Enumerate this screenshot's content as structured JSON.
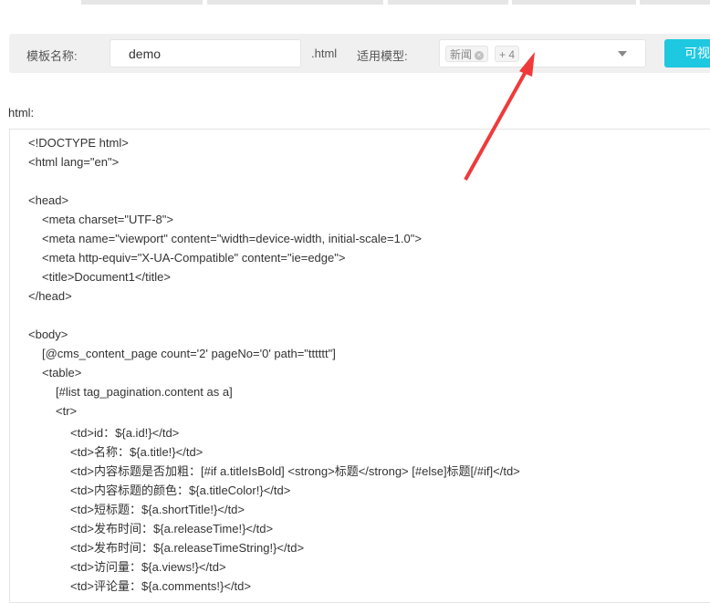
{
  "form": {
    "template_name_label": "模板名称:",
    "template_name_value": "demo",
    "suffix": ".html",
    "model_label": "适用模型:",
    "model_tags": [
      "新闻",
      "+ 4"
    ],
    "visual_button": "可视"
  },
  "html_label": "html:",
  "code_lines": [
    {
      "i": 0,
      "t": "<!DOCTYPE html>"
    },
    {
      "i": 0,
      "t": "<html lang=\"en\">"
    },
    {
      "i": 0,
      "t": ""
    },
    {
      "i": 0,
      "t": "<head>"
    },
    {
      "i": 1,
      "t": "<meta charset=\"UTF-8\">"
    },
    {
      "i": 1,
      "t": "<meta name=\"viewport\" content=\"width=device-width, initial-scale=1.0\">"
    },
    {
      "i": 1,
      "t": "<meta http-equiv=\"X-UA-Compatible\" content=\"ie=edge\">"
    },
    {
      "i": 1,
      "t": "<title>Document1</title>"
    },
    {
      "i": 0,
      "t": "</head>"
    },
    {
      "i": 0,
      "t": ""
    },
    {
      "i": 0,
      "t": "<body>"
    },
    {
      "i": 1,
      "t": "[@cms_content_page count='2' pageNo='0' path=\"tttttt\"]"
    },
    {
      "i": 1,
      "t": "<table>"
    },
    {
      "i": 2,
      "t": "[#list tag_pagination.content as a]"
    },
    {
      "i": 2,
      "t": "<tr>"
    },
    {
      "i": 3,
      "t": "<td>id：${a.id!}</td>"
    },
    {
      "i": 3,
      "t": "<td>名称：${a.title!}</td>"
    },
    {
      "i": 3,
      "t": "<td>内容标题是否加粗：[#if a.titleIsBold] <strong>标题</strong> [#else]标题[/#if]</td>"
    },
    {
      "i": 3,
      "t": "<td>内容标题的颜色：${a.titleColor!}</td>"
    },
    {
      "i": 3,
      "t": "<td>短标题：${a.shortTitle!}</td>"
    },
    {
      "i": 3,
      "t": "<td>发布时间：${a.releaseTime!}</td>"
    },
    {
      "i": 3,
      "t": "<td>发布时间：${a.releaseTimeString!}</td>"
    },
    {
      "i": 3,
      "t": "<td>访问量：${a.views!}</td>"
    },
    {
      "i": 3,
      "t": "<td>评论量：${a.comments!}</td>"
    }
  ]
}
